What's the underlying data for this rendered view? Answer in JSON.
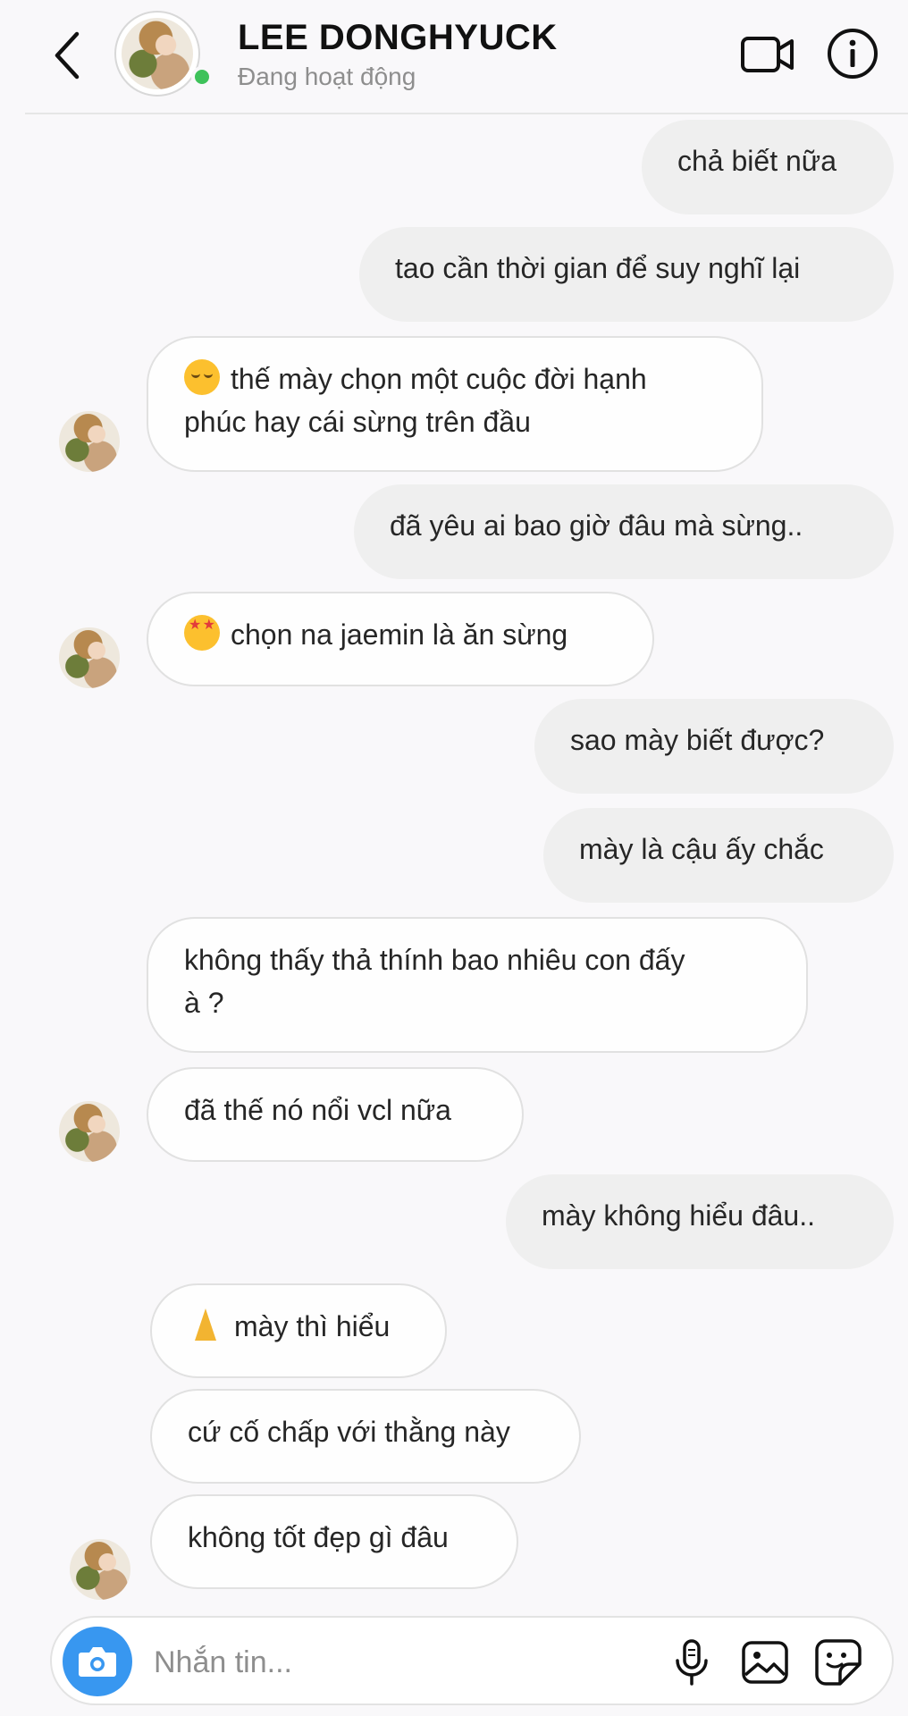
{
  "header": {
    "contact_name": "LEE DONGHYUCK",
    "status": "Đang hoạt động",
    "icons": [
      "back-chevron-icon",
      "video-call-icon",
      "info-icon"
    ]
  },
  "messages": [
    {
      "dir": "sent",
      "text": "chả biết nữa"
    },
    {
      "dir": "sent",
      "text": "tao cần thời gian để suy nghĩ lại"
    },
    {
      "dir": "received",
      "emoji": "relieved-face",
      "text": "thế mày chọn một cuộc đời hạnh\nphúc hay cái sừng trên đầu"
    },
    {
      "dir": "sent",
      "text": "đã yêu ai bao giờ đâu mà sừng.."
    },
    {
      "dir": "received",
      "emoji": "star-struck-face",
      "text": "chọn na jaemin là ăn sừng"
    },
    {
      "dir": "sent",
      "text": "sao mày biết được?"
    },
    {
      "dir": "sent",
      "text": "mày là cậu ấy chắc"
    },
    {
      "dir": "received",
      "text": "không thấy thả thính bao nhiêu con đấy\nà ?"
    },
    {
      "dir": "received",
      "text": "đã thế nó nổi vcl nữa"
    },
    {
      "dir": "sent",
      "text": "mày không hiểu đâu.."
    },
    {
      "dir": "received",
      "emoji": "folded-hands",
      "text": "mày thì hiểu"
    },
    {
      "dir": "received",
      "text": "cứ cố chấp với thằng này"
    },
    {
      "dir": "received",
      "text": "không tốt đẹp gì đâu"
    }
  ],
  "composer": {
    "placeholder": "Nhắn tin...",
    "icons": [
      "camera-icon",
      "microphone-icon",
      "gallery-icon",
      "sticker-icon"
    ]
  },
  "colors": {
    "background": "#f9f8fa",
    "sent_bubble": "#efefef",
    "received_bubble": "#fefefe",
    "online": "#3ec25a",
    "camera_button": "#3897f0"
  }
}
